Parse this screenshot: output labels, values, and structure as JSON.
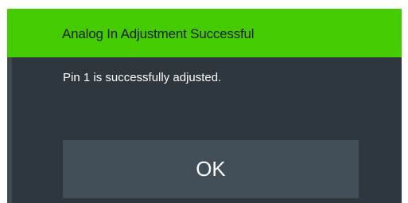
{
  "dialog": {
    "title": "Analog In Adjustment Successful",
    "message": "Pin 1 is successfully adjusted.",
    "ok_label": "OK"
  },
  "colors": {
    "title_bar": "#44cc00",
    "background": "#2e373d",
    "button": "#414e58",
    "text": "#ffffff"
  }
}
